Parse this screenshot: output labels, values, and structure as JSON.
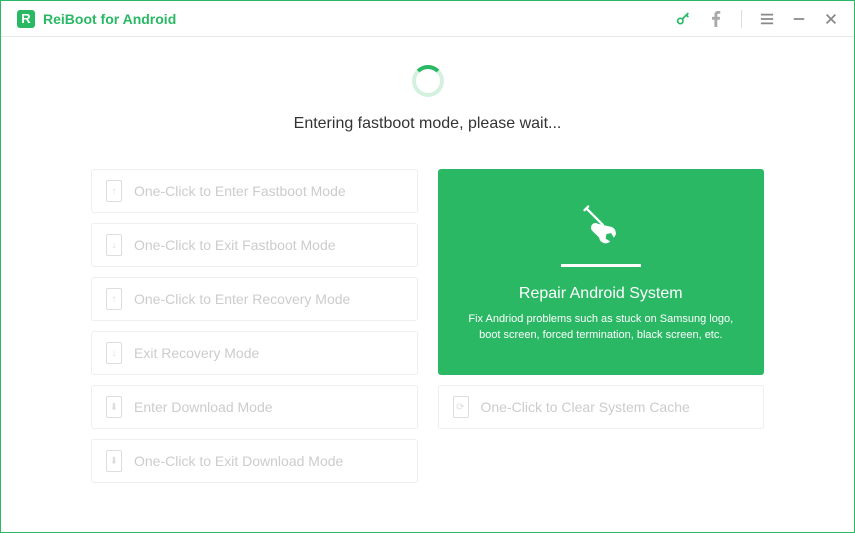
{
  "app": {
    "title": "ReiBoot for Android",
    "logo_letter": "R"
  },
  "status": {
    "text": "Entering fastboot mode, please wait..."
  },
  "left_options": [
    {
      "label": "One-Click to Enter Fastboot Mode",
      "icon_glyph": "↑"
    },
    {
      "label": "One-Click to Exit Fastboot Mode",
      "icon_glyph": "↓"
    },
    {
      "label": "One-Click to Enter Recovery Mode",
      "icon_glyph": "↑"
    },
    {
      "label": "Exit Recovery Mode",
      "icon_glyph": "↓"
    },
    {
      "label": "Enter Download Mode",
      "icon_glyph": "⬇"
    },
    {
      "label": "One-Click to Exit Download Mode",
      "icon_glyph": "⬇"
    }
  ],
  "repair": {
    "title": "Repair Android System",
    "description": "Fix Andriod problems such as stuck on Samsung logo, boot screen, forced termination, black screen, etc."
  },
  "cache_option": {
    "label": "One-Click to Clear System Cache",
    "icon_glyph": "⟳"
  },
  "colors": {
    "primary": "#2ab865"
  }
}
